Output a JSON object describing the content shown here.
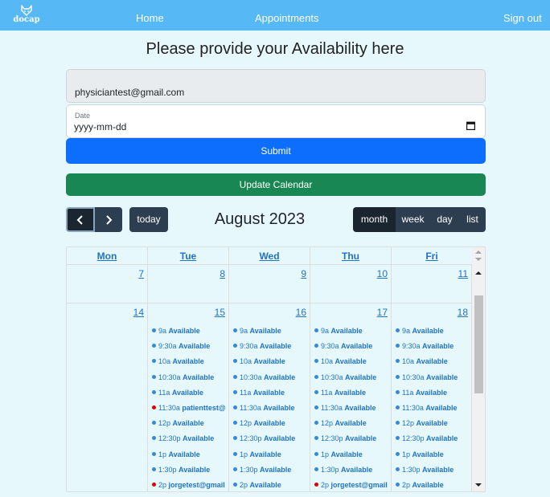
{
  "nav": {
    "logo_text": "docap",
    "home": "Home",
    "appointments": "Appointments",
    "signout": "Sign out"
  },
  "heading": "Please provide your Availability here",
  "form": {
    "email_value": "physiciantest@gmail.com",
    "date_label": "Date",
    "date_placeholder": "yyyy-mm-dd",
    "submit_label": "Submit"
  },
  "update_calendar_label": "Update Calendar",
  "calendar": {
    "today_label": "today",
    "title": "August 2023",
    "views": [
      "month",
      "week",
      "day",
      "list"
    ],
    "active_view": "month",
    "day_headers": [
      "Mon",
      "Tue",
      "Wed",
      "Thu",
      "Fri"
    ],
    "week1_days": [
      "7",
      "8",
      "9",
      "10",
      "11"
    ],
    "week2_days": [
      "14",
      "15",
      "16",
      "17",
      "18"
    ],
    "events": {
      "15": [
        {
          "time": "9a",
          "title": "Available",
          "color": "#3788d8"
        },
        {
          "time": "9:30a",
          "title": "Available",
          "color": "#3788d8"
        },
        {
          "time": "10a",
          "title": "Available",
          "color": "#3788d8"
        },
        {
          "time": "10:30a",
          "title": "Available",
          "color": "#3788d8"
        },
        {
          "time": "11a",
          "title": "Available",
          "color": "#3788d8"
        },
        {
          "time": "11:30a",
          "title": "patienttest@",
          "color": "#e00000"
        },
        {
          "time": "12p",
          "title": "Available",
          "color": "#3788d8"
        },
        {
          "time": "12:30p",
          "title": "Available",
          "color": "#3788d8"
        },
        {
          "time": "1p",
          "title": "Available",
          "color": "#3788d8"
        },
        {
          "time": "1:30p",
          "title": "Available",
          "color": "#3788d8"
        },
        {
          "time": "2p",
          "title": "jorgetest@gmail",
          "color": "#e00000"
        }
      ],
      "16": [
        {
          "time": "9a",
          "title": "Available",
          "color": "#3788d8"
        },
        {
          "time": "9:30a",
          "title": "Available",
          "color": "#3788d8"
        },
        {
          "time": "10a",
          "title": "Available",
          "color": "#3788d8"
        },
        {
          "time": "10:30a",
          "title": "Available",
          "color": "#3788d8"
        },
        {
          "time": "11a",
          "title": "Available",
          "color": "#3788d8"
        },
        {
          "time": "11:30a",
          "title": "Available",
          "color": "#3788d8"
        },
        {
          "time": "12p",
          "title": "Available",
          "color": "#3788d8"
        },
        {
          "time": "12:30p",
          "title": "Available",
          "color": "#3788d8"
        },
        {
          "time": "1p",
          "title": "Available",
          "color": "#3788d8"
        },
        {
          "time": "1:30p",
          "title": "Available",
          "color": "#3788d8"
        },
        {
          "time": "2p",
          "title": "Available",
          "color": "#3788d8"
        }
      ],
      "17": [
        {
          "time": "9a",
          "title": "Available",
          "color": "#3788d8"
        },
        {
          "time": "9:30a",
          "title": "Available",
          "color": "#3788d8"
        },
        {
          "time": "10a",
          "title": "Available",
          "color": "#3788d8"
        },
        {
          "time": "10:30a",
          "title": "Available",
          "color": "#3788d8"
        },
        {
          "time": "11a",
          "title": "Available",
          "color": "#3788d8"
        },
        {
          "time": "11:30a",
          "title": "Available",
          "color": "#3788d8"
        },
        {
          "time": "12p",
          "title": "Available",
          "color": "#3788d8"
        },
        {
          "time": "12:30p",
          "title": "Available",
          "color": "#3788d8"
        },
        {
          "time": "1p",
          "title": "Available",
          "color": "#3788d8"
        },
        {
          "time": "1:30p",
          "title": "Available",
          "color": "#3788d8"
        },
        {
          "time": "2p",
          "title": "jorgetest@gmail",
          "color": "#e00000"
        }
      ],
      "18": [
        {
          "time": "9a",
          "title": "Available",
          "color": "#3788d8"
        },
        {
          "time": "9:30a",
          "title": "Available",
          "color": "#3788d8"
        },
        {
          "time": "10a",
          "title": "Available",
          "color": "#3788d8"
        },
        {
          "time": "10:30a",
          "title": "Available",
          "color": "#3788d8"
        },
        {
          "time": "11a",
          "title": "Available",
          "color": "#3788d8"
        },
        {
          "time": "11:30a",
          "title": "Available",
          "color": "#3788d8"
        },
        {
          "time": "12p",
          "title": "Available",
          "color": "#3788d8"
        },
        {
          "time": "12:30p",
          "title": "Available",
          "color": "#3788d8"
        },
        {
          "time": "1p",
          "title": "Available",
          "color": "#3788d8"
        },
        {
          "time": "1:30p",
          "title": "Available",
          "color": "#3788d8"
        },
        {
          "time": "2p",
          "title": "Available",
          "color": "#3788d8"
        }
      ]
    }
  },
  "colors": {
    "navbar": "#56b8f5",
    "background": "#e6f8fb",
    "primary": "#0d6efd",
    "success": "#198754",
    "fc_button": "#2c3e50",
    "link": "#1f73c7",
    "available_dot": "#3788d8",
    "booked_dot": "#e00000"
  }
}
